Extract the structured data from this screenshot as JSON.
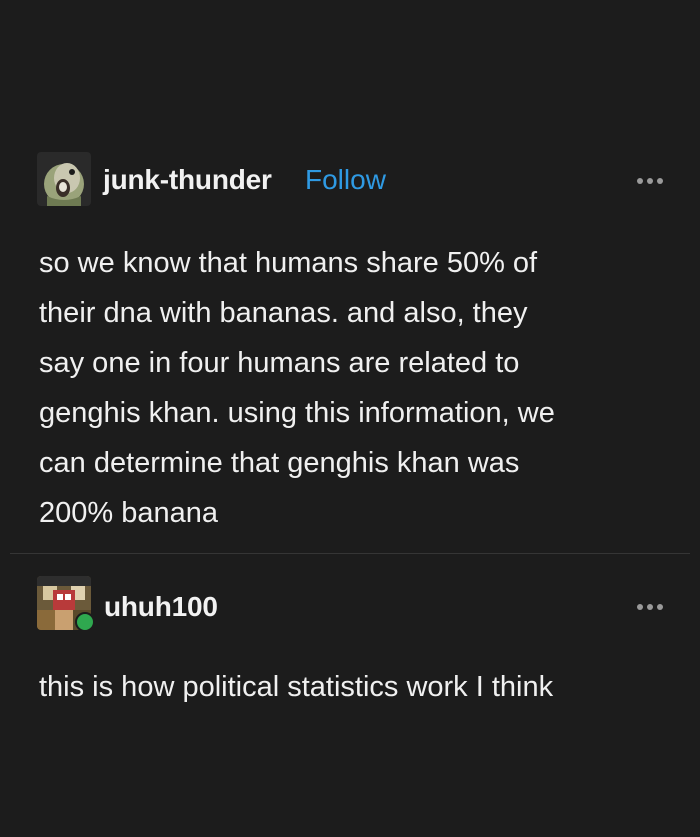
{
  "posts": [
    {
      "username": "junk-thunder",
      "follow_label": "Follow",
      "body": "so we know that humans share 50% of\ntheir dna with bananas. and also, they\nsay one in four humans are related to\ngenghis khan. using this information, we\ncan determine that genghis khan was\n200% banana",
      "more_icon": "more-horizontal-icon"
    },
    {
      "username": "uhuh100",
      "body": "this is how political statistics work I think",
      "more_icon": "more-horizontal-icon",
      "badge_icon": "reblog-icon"
    }
  ],
  "colors": {
    "background": "#1c1c1c",
    "text": "#f0f0f0",
    "follow": "#2f9ae3",
    "badge": "#2fa84f",
    "divider": "#353535"
  }
}
